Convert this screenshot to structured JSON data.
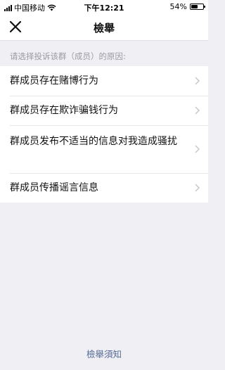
{
  "status_bar": {
    "carrier": "中国移动",
    "time": "下午12:21",
    "battery": "54%",
    "battery_level": 0.54
  },
  "header": {
    "title": "檢舉"
  },
  "hint": "请选择投诉该群（成员）的原因:",
  "reasons": [
    {
      "label": "群成员存在赌博行为"
    },
    {
      "label": "群成员存在欺诈骗钱行为"
    },
    {
      "label": "群成员发布不适当的信息对我造成骚扰"
    },
    {
      "label": "群成员传播谣言信息"
    }
  ],
  "footer": {
    "link": "檢舉須知"
  },
  "colors": {
    "background": "#efeff4",
    "link": "#576b95"
  }
}
